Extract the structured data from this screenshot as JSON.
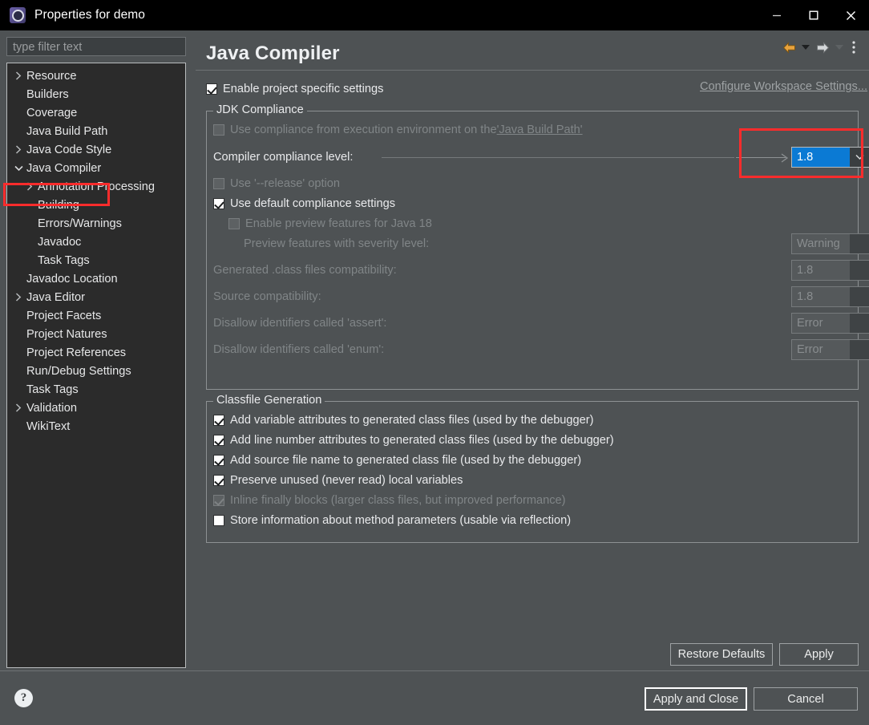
{
  "window": {
    "title": "Properties for demo",
    "icon": "eclipse-gear-icon",
    "minimize_label": "Minimize",
    "maximize_label": "Maximize",
    "close_label": "Close"
  },
  "sidebar": {
    "filter_placeholder": "type filter text",
    "filter_value": "",
    "selected": "Java Compiler",
    "items": [
      {
        "label": "Resource",
        "level": 0,
        "twisty": "collapsed"
      },
      {
        "label": "Builders",
        "level": 0,
        "twisty": "none"
      },
      {
        "label": "Coverage",
        "level": 0,
        "twisty": "none"
      },
      {
        "label": "Java Build Path",
        "level": 0,
        "twisty": "none"
      },
      {
        "label": "Java Code Style",
        "level": 0,
        "twisty": "collapsed"
      },
      {
        "label": "Java Compiler",
        "level": 0,
        "twisty": "expanded"
      },
      {
        "label": "Annotation Processing",
        "level": 1,
        "twisty": "collapsed"
      },
      {
        "label": "Building",
        "level": 1,
        "twisty": "none"
      },
      {
        "label": "Errors/Warnings",
        "level": 1,
        "twisty": "none"
      },
      {
        "label": "Javadoc",
        "level": 1,
        "twisty": "none"
      },
      {
        "label": "Task Tags",
        "level": 1,
        "twisty": "none"
      },
      {
        "label": "Javadoc Location",
        "level": 0,
        "twisty": "none"
      },
      {
        "label": "Java Editor",
        "level": 0,
        "twisty": "collapsed"
      },
      {
        "label": "Project Facets",
        "level": 0,
        "twisty": "none"
      },
      {
        "label": "Project Natures",
        "level": 0,
        "twisty": "none"
      },
      {
        "label": "Project References",
        "level": 0,
        "twisty": "none"
      },
      {
        "label": "Run/Debug Settings",
        "level": 0,
        "twisty": "none"
      },
      {
        "label": "Task Tags",
        "level": 0,
        "twisty": "none"
      },
      {
        "label": "Validation",
        "level": 0,
        "twisty": "collapsed"
      },
      {
        "label": "WikiText",
        "level": 0,
        "twisty": "none"
      }
    ]
  },
  "page": {
    "title": "Java Compiler",
    "nav": {
      "back_icon": "back-arrow-icon",
      "back_caret_icon": "chevron-down-icon",
      "forward_icon": "forward-arrow-icon",
      "forward_caret_icon": "chevron-down-icon",
      "menu_icon": "vertical-dots-icon"
    },
    "enable_project_specific": {
      "label": "Enable project specific settings",
      "checked": true
    },
    "workspace_link": "Configure Workspace Settings..."
  },
  "jdk_compliance": {
    "legend": "JDK Compliance",
    "use_execution_env": {
      "label_prefix": "Use compliance from execution environment on the ",
      "label_link": "'Java Build Path'",
      "checked": false,
      "enabled": false
    },
    "compliance_level_label": "Compiler compliance level:",
    "compliance_level_value": "1.8",
    "use_release": {
      "label": "Use '--release' option",
      "checked": false,
      "enabled": false
    },
    "use_default_compliance": {
      "label": "Use default compliance settings",
      "checked": true,
      "enabled": true
    },
    "enable_preview": {
      "label": "Enable preview features for Java 18",
      "checked": false,
      "enabled": false
    },
    "rows": [
      {
        "label": "Preview features with severity level:",
        "value": "Warning",
        "enabled": false
      },
      {
        "label": "Generated .class files compatibility:",
        "value": "1.8",
        "enabled": false
      },
      {
        "label": "Source compatibility:",
        "value": "1.8",
        "enabled": false
      },
      {
        "label": "Disallow identifiers called 'assert':",
        "value": "Error",
        "enabled": false
      },
      {
        "label": "Disallow identifiers called 'enum':",
        "value": "Error",
        "enabled": false
      }
    ]
  },
  "classfile_generation": {
    "legend": "Classfile Generation",
    "options": [
      {
        "label": "Add variable attributes to generated class files (used by the debugger)",
        "checked": true,
        "enabled": true
      },
      {
        "label": "Add line number attributes to generated class files (used by the debugger)",
        "checked": true,
        "enabled": true
      },
      {
        "label": "Add source file name to generated class file (used by the debugger)",
        "checked": true,
        "enabled": true
      },
      {
        "label": "Preserve unused (never read) local variables",
        "checked": true,
        "enabled": true
      },
      {
        "label": "Inline finally blocks (larger class files, but improved performance)",
        "checked": true,
        "enabled": false
      },
      {
        "label": "Store information about method parameters (usable via reflection)",
        "checked": false,
        "enabled": true
      }
    ]
  },
  "buttons": {
    "restore_defaults": "Restore Defaults",
    "apply": "Apply",
    "apply_and_close": "Apply and Close",
    "cancel": "Cancel",
    "help_icon": "help-question-icon"
  },
  "colors": {
    "accent_selected": "#0b7ad4",
    "highlight_box": "#fb2c2c",
    "dialog_bg": "#4e5254",
    "tree_bg": "#2b2b2b",
    "titlebar_bg": "#000000",
    "nav_back_arrow": "#e8a33d"
  }
}
